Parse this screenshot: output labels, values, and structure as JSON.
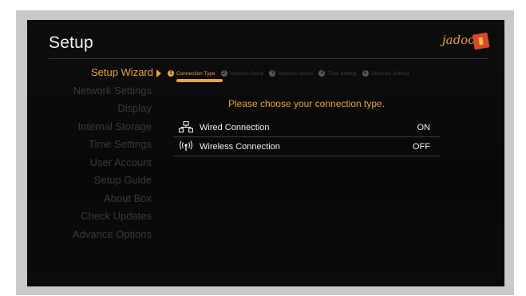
{
  "header": {
    "title": "Setup",
    "logo_text": "jadoo"
  },
  "menu": {
    "items": [
      {
        "label": "Setup Wizard",
        "active": true
      },
      {
        "label": "Network Settings",
        "active": false
      },
      {
        "label": "Display",
        "active": false
      },
      {
        "label": "Internal Storage",
        "active": false
      },
      {
        "label": "Time Settings",
        "active": false
      },
      {
        "label": "User Account",
        "active": false
      },
      {
        "label": "Setup Guide",
        "active": false
      },
      {
        "label": "About Box",
        "active": false
      },
      {
        "label": "Check Updates",
        "active": false
      },
      {
        "label": "Advance Options",
        "active": false
      }
    ]
  },
  "wizard": {
    "steps": [
      {
        "num": "1",
        "label": "Connection Type",
        "active": true
      },
      {
        "num": "2",
        "label": "Network Setup",
        "active": false
      },
      {
        "num": "3",
        "label": "Network Status",
        "active": false
      },
      {
        "num": "4",
        "label": "Time Setting",
        "active": false
      },
      {
        "num": "5",
        "label": "Glossary Setting",
        "active": false
      }
    ],
    "prompt": "Please choose your connection type.",
    "options": [
      {
        "icon": "network-icon",
        "label": "Wired Connection",
        "value": "ON"
      },
      {
        "icon": "wireless-icon",
        "label": "Wireless Connection",
        "value": "OFF"
      }
    ]
  },
  "colors": {
    "accent": "#e8a53a",
    "background": "#0b0b0b",
    "text": "#f0f0f0",
    "dim_text": "#3a3a3a"
  }
}
